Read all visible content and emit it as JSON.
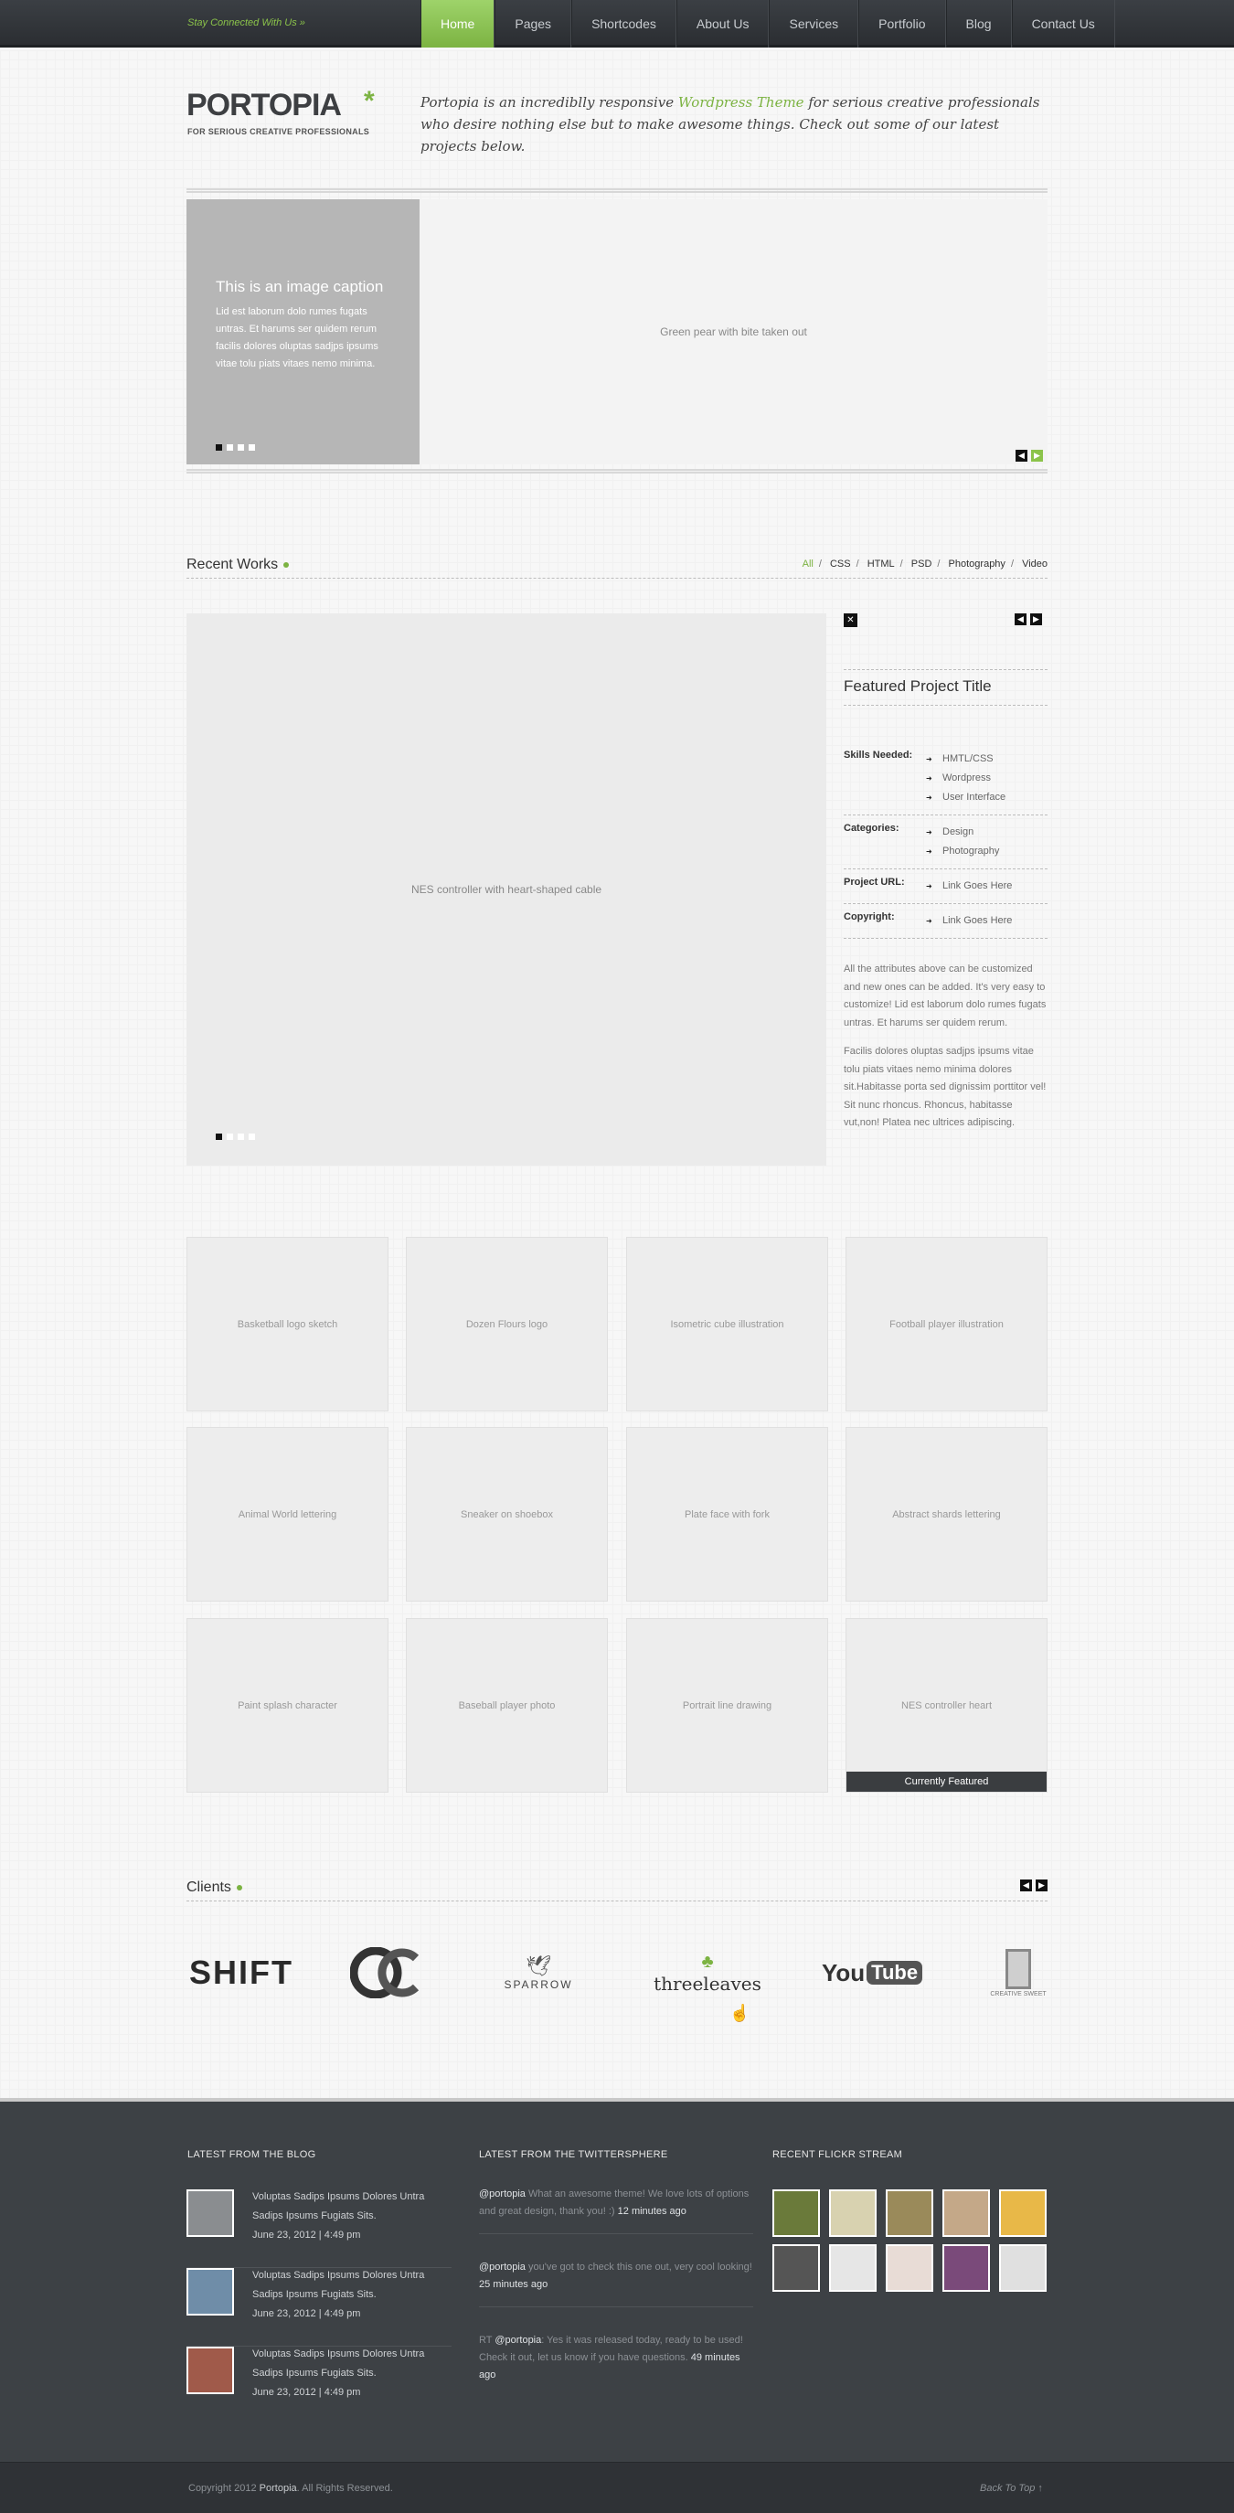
{
  "topbar": {
    "stay_connected": "Stay Connected With Us  »"
  },
  "nav": [
    {
      "label": "Home",
      "active": true
    },
    {
      "label": "Pages"
    },
    {
      "label": "Shortcodes"
    },
    {
      "label": "About Us"
    },
    {
      "label": "Services"
    },
    {
      "label": "Portfolio"
    },
    {
      "label": "Blog"
    },
    {
      "label": "Contact Us"
    }
  ],
  "brand": {
    "name": "PORTOPIA",
    "star": "*",
    "tagline": "FOR SERIOUS CREATIVE PROFESSIONALS"
  },
  "intro": {
    "before": "Portopia is an incrediblly responsive ",
    "highlight": "Wordpress Theme",
    "after": " for serious creative professionals who desire nothing else but to make awesome things. Check out some of our latest projects below."
  },
  "slider": {
    "caption_title": "This is an image caption",
    "caption_text": "Lid est laborum dolo rumes fugats untras. Et harums ser quidem rerum facilis dolores oluptas sadjps ipsums vitae tolu piats vitaes nemo minima.",
    "image": "Green pear with bite taken out",
    "active_slide": 1,
    "slide_count": 4
  },
  "recent_works": {
    "title": "Recent Works",
    "filters": [
      "All",
      "CSS",
      "HTML",
      "PSD",
      "Photography",
      "Video"
    ],
    "active_filter": "All"
  },
  "featured": {
    "image": "NES controller with heart-shaped cable",
    "close": "✕",
    "title": "Featured Project Title",
    "skills_label": "Skills Needed:",
    "skills": [
      "HMTL/CSS",
      "Wordpress",
      "User Interface"
    ],
    "categories_label": "Categories:",
    "categories": [
      "Design",
      "Photography"
    ],
    "url_label": "Project URL:",
    "url": "Link Goes Here",
    "copyright_label": "Copyright:",
    "copyright": "Link Goes Here",
    "desc1": "All the attributes above can be customized and new ones can be added.  It's very easy to customize!   Lid est laborum dolo rumes fugats untras. Et harums ser quidem rerum.",
    "desc2": "Facilis dolores oluptas sadjps ipsums vitae tolu piats vitaes nemo minima dolores sit.Habitasse porta sed dignissim porttitor vel! Sit nunc rhoncus. Rhoncus, habitasse vut,non! Platea nec ultrices adipiscing."
  },
  "portfolio": [
    "Basketball logo sketch",
    "Dozen Flours logo",
    "Isometric cube illustration",
    "Football player illustration",
    "Animal World lettering",
    "Sneaker on shoebox",
    "Plate face with fork",
    "Abstract shards lettering",
    "Paint splash character",
    "Baseball player photo",
    "Portrait line drawing",
    "NES controller heart"
  ],
  "currently_featured": "Currently Featured",
  "clients": {
    "title": "Clients",
    "logos": [
      {
        "name": "SHIFT"
      },
      {
        "name": "OC"
      },
      {
        "name": "SPARROW"
      },
      {
        "name": "threeleaves"
      },
      {
        "name": "You",
        "name2": "Tube"
      },
      {
        "name": "CREATIVE SWEET"
      }
    ]
  },
  "footer": {
    "blog_title": "LATEST FROM THE BLOG",
    "twitter_title": "LATEST FROM THE TWITTERSPHERE",
    "flickr_title": "RECENT FLICKR STREAM",
    "blog": [
      {
        "title": "Voluptas Sadips Ipsums Dolores Untra Sadips Ipsums Fugiats Sits.",
        "date": "June 23, 2012   |   4:49 pm"
      },
      {
        "title": "Voluptas Sadips Ipsums Dolores Untra Sadips Ipsums Fugiats Sits.",
        "date": "June 23, 2012   |   4:49 pm"
      },
      {
        "title": "Voluptas Sadips Ipsums Dolores Untra Sadips Ipsums Fugiats Sits.",
        "date": "June 23, 2012   |   4:49 pm"
      }
    ],
    "tweets": [
      {
        "prefix": "",
        "handle": "@portopia",
        "text": " What an awesome theme!  We love lots of options and great design, thank you!  :) ",
        "time": "12 minutes ago"
      },
      {
        "prefix": "",
        "handle": "@portopia",
        "text": " you've got to check this one out, very cool looking! ",
        "time": "25 minutes ago"
      },
      {
        "prefix": "RT ",
        "handle": "@portopia",
        "text": ": Yes it was released today, ready to be used! Check it out, let us know if you have questions. ",
        "time": "49 minutes ago"
      }
    ],
    "flickr_count": 10
  },
  "bottom": {
    "copyright_before": "Copyright 2012 ",
    "brand": "Portopia",
    "copyright_after": ". All Rights Reserved.",
    "back_to_top": "Back To Top  ↑"
  }
}
